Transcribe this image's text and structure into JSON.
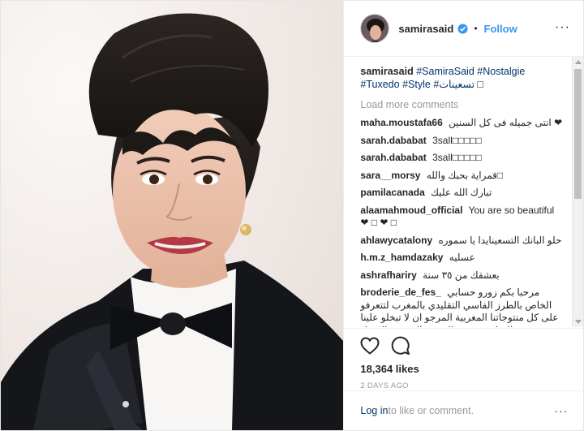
{
  "header": {
    "username": "samirasaid",
    "separator": "•",
    "follow_label": "Follow",
    "more_icon": "···"
  },
  "caption": {
    "username": "samirasaid",
    "hashtags": [
      "#SamiraSaid",
      "#Nostalgie",
      "#Tuxedo",
      "#Style",
      "#تسعينات"
    ],
    "trailing": "□"
  },
  "load_more": "Load more comments",
  "comments": [
    {
      "user": "maha.moustafa66",
      "text": "انتى جميله فى كل السنين ❤"
    },
    {
      "user": "sarah.dababat",
      "text": "3sall□□□□□"
    },
    {
      "user": "sarah.dababat",
      "text": "3sall□□□□□"
    },
    {
      "user": "sara__morsy",
      "text": "قمراية بحبك والله□"
    },
    {
      "user": "pamilacanada",
      "text": "تبارك الله عليك"
    },
    {
      "user": "alaamahmoud_official",
      "text": "You are so beautiful ❤ □ ❤ □"
    },
    {
      "user": "ahlawycatalony",
      "text": "حلو البانك التسعينايدا يا سموره"
    },
    {
      "user": "h.m.z_hamdazaky",
      "text": "عسليه"
    },
    {
      "user": "ashrafhariry",
      "text": "بعشقك من ٣٥ سنة"
    },
    {
      "user": "broderie_de_fes_",
      "text": "مرحبا بكم زورو حسابي الخاص بالطرز الفاسي التقليدي بالمغرب لتتعرفو على كل منتوجاتنا المغربية المرجو ان لا تبخلو علينا بالمتابعة شجعو المنتوج المغربي الاصيل"
    }
  ],
  "stats": {
    "likes": "18,364 likes",
    "date": "2 DAYS AGO"
  },
  "footer": {
    "login_label": "Log in",
    "rest_label": " to like or comment.",
    "more_icon": "···"
  },
  "colors": {
    "link_blue": "#3897f0",
    "hashtag_navy": "#003569",
    "muted_gray": "#999999",
    "verified_blue": "#3897f0"
  },
  "icons": [
    "heart-icon",
    "comment-icon",
    "verified-badge-icon",
    "more-options-icon"
  ]
}
